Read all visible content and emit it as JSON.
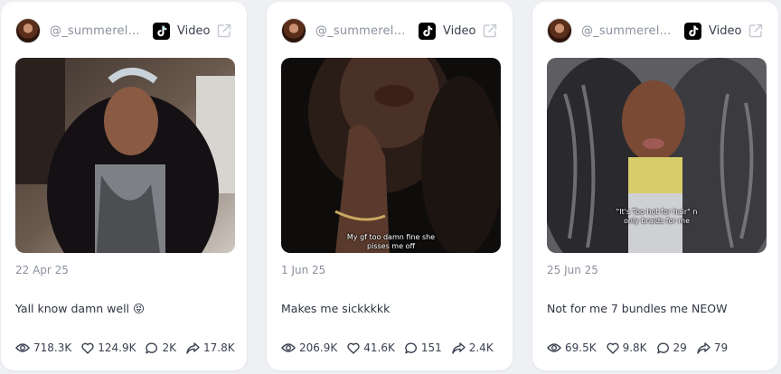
{
  "cards": [
    {
      "handle": "@_summerelleee",
      "type": "Video",
      "date": "22 Apr 25",
      "text": "Yall know damn well 😝",
      "caption": "",
      "views": "718.3K",
      "likes": "124.9K",
      "comments": "2K",
      "shares": "17.8K"
    },
    {
      "handle": "@_summerelleee",
      "type": "Video",
      "date": "1 Jun 25",
      "text": "Makes me sickkkkk",
      "caption": "My gf too damn fine she pisses me off",
      "views": "206.9K",
      "likes": "41.6K",
      "comments": "151",
      "shares": "2.4K"
    },
    {
      "handle": "@_summerelleee",
      "type": "Video",
      "date": "25 Jun 25",
      "text": "Not for me 7 bundles me NEOW",
      "caption": "\"It's Too hot for hair\" n only braids for me",
      "views": "69.5K",
      "likes": "9.8K",
      "comments": "29",
      "shares": "79"
    }
  ],
  "icons": {
    "platform": "tiktok-icon",
    "external": "external-link-icon",
    "views": "eye-icon",
    "likes": "heart-icon",
    "comments": "comment-icon",
    "shares": "share-icon"
  },
  "colors": {
    "background": "#eef0f4",
    "card": "#ffffff",
    "muted_text": "#8a909c",
    "body_text": "#2f3442"
  }
}
